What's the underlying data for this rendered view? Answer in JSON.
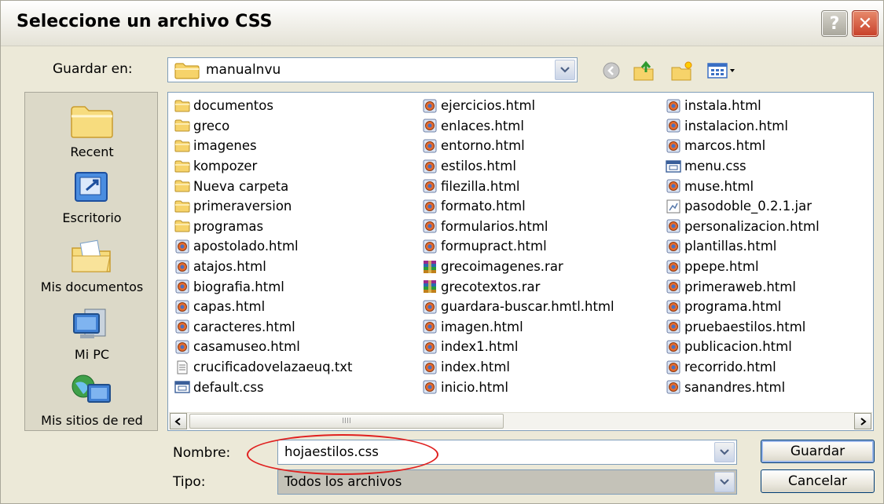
{
  "window": {
    "title": "Seleccione un archivo CSS"
  },
  "titlebar": {
    "help_label": "?",
    "close_label": "✕"
  },
  "location": {
    "label": "Guardar en:",
    "value": "manualnvu"
  },
  "places": [
    {
      "label": "Recent",
      "icon": "recent-folder-icon"
    },
    {
      "label": "Escritorio",
      "icon": "desktop-icon"
    },
    {
      "label": "Mis documentos",
      "icon": "my-documents-icon"
    },
    {
      "label": "Mi PC",
      "icon": "my-computer-icon"
    },
    {
      "label": "Mis sitios de red",
      "icon": "network-places-icon"
    }
  ],
  "files": {
    "col1": [
      {
        "name": "documentos",
        "type": "folder"
      },
      {
        "name": "greco",
        "type": "folder"
      },
      {
        "name": "imagenes",
        "type": "folder"
      },
      {
        "name": "kompozer",
        "type": "folder"
      },
      {
        "name": "Nueva carpeta",
        "type": "folder"
      },
      {
        "name": "primeraversion",
        "type": "folder"
      },
      {
        "name": "programas",
        "type": "folder"
      },
      {
        "name": "apostolado.html",
        "type": "html"
      },
      {
        "name": "atajos.html",
        "type": "html"
      },
      {
        "name": "biografia.html",
        "type": "html"
      },
      {
        "name": "capas.html",
        "type": "html"
      },
      {
        "name": "caracteres.html",
        "type": "html"
      },
      {
        "name": "casamuseo.html",
        "type": "html"
      },
      {
        "name": "crucificadovelazaeuq.txt",
        "type": "txt"
      },
      {
        "name": "default.css",
        "type": "css"
      }
    ],
    "col2": [
      {
        "name": "ejercicios.html",
        "type": "html"
      },
      {
        "name": "enlaces.html",
        "type": "html"
      },
      {
        "name": "entorno.html",
        "type": "html"
      },
      {
        "name": "estilos.html",
        "type": "html"
      },
      {
        "name": "filezilla.html",
        "type": "html"
      },
      {
        "name": "formato.html",
        "type": "html"
      },
      {
        "name": "formularios.html",
        "type": "html"
      },
      {
        "name": "formupract.html",
        "type": "html"
      },
      {
        "name": "grecoimagenes.rar",
        "type": "rar"
      },
      {
        "name": "grecotextos.rar",
        "type": "rar"
      },
      {
        "name": "guardara-buscar.hmtl.html",
        "type": "html"
      },
      {
        "name": "imagen.html",
        "type": "html"
      },
      {
        "name": "index1.html",
        "type": "html"
      },
      {
        "name": "index.html",
        "type": "html"
      },
      {
        "name": "inicio.html",
        "type": "html"
      }
    ],
    "col3": [
      {
        "name": "instala.html",
        "type": "html"
      },
      {
        "name": "instalacion.html",
        "type": "html"
      },
      {
        "name": "marcos.html",
        "type": "html"
      },
      {
        "name": "menu.css",
        "type": "css"
      },
      {
        "name": "muse.html",
        "type": "html"
      },
      {
        "name": "pasodoble_0.2.1.jar",
        "type": "jar"
      },
      {
        "name": "personalizacion.html",
        "type": "html"
      },
      {
        "name": "plantillas.html",
        "type": "html"
      },
      {
        "name": "ppepe.html",
        "type": "html"
      },
      {
        "name": "primeraweb.html",
        "type": "html"
      },
      {
        "name": "programa.html",
        "type": "html"
      },
      {
        "name": "pruebaestilos.html",
        "type": "html"
      },
      {
        "name": "publicacion.html",
        "type": "html"
      },
      {
        "name": "recorrido.html",
        "type": "html"
      },
      {
        "name": "sanandres.html",
        "type": "html"
      }
    ]
  },
  "scrollbar": {
    "thumb_grip": "IIII"
  },
  "filename": {
    "label": "Nombre:",
    "value": "hojaestilos.css"
  },
  "filetype": {
    "label": "Tipo:",
    "value": "Todos los archivos"
  },
  "buttons": {
    "save": "Guardar",
    "cancel": "Cancelar"
  },
  "colors": {
    "accent_annotation": "#e0201f",
    "folder": "#f5d66b",
    "border": "#7f9db9"
  }
}
